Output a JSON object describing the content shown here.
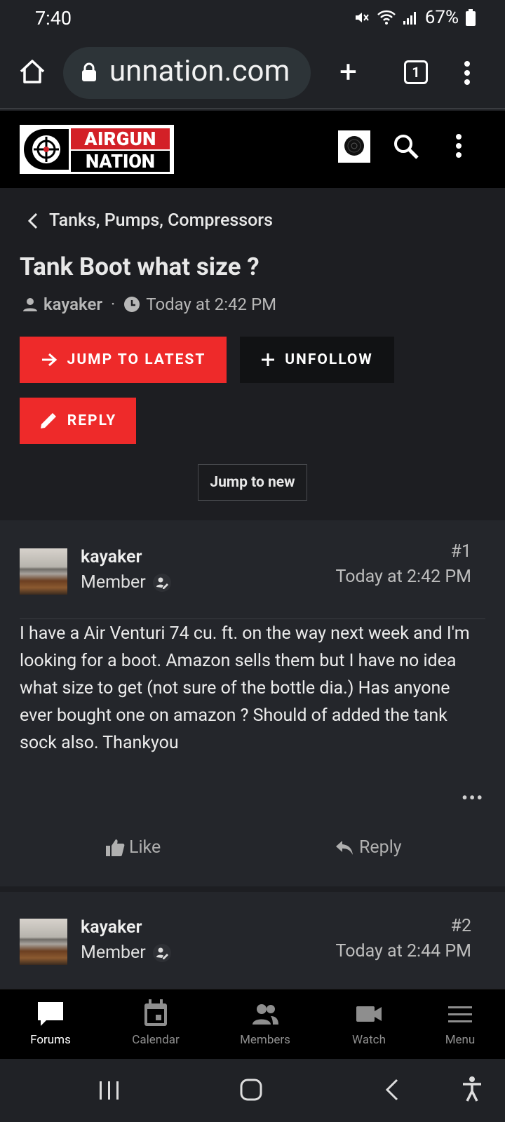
{
  "status_bar": {
    "time": "7:40",
    "battery": "67%"
  },
  "browser": {
    "url": "unnation.com",
    "tab_count": "1"
  },
  "site": {
    "logo_top": "AIRGUN",
    "logo_bottom": "NATION"
  },
  "thread": {
    "breadcrumb": "Tanks, Pumps, Compressors",
    "title": "Tank Boot what size ?",
    "author": "kayaker",
    "separator": "·",
    "time": "Today at 2:42 PM",
    "buttons": {
      "jump_latest": "JUMP TO LATEST",
      "unfollow": "UNFOLLOW",
      "reply": "REPLY",
      "jump_new": "Jump to new"
    }
  },
  "posts": [
    {
      "username": "kayaker",
      "role": "Member",
      "number": "#1",
      "time": "Today at 2:42 PM",
      "body": "I have a Air Venturi 74 cu. ft. on the way next week and I'm looking for a boot. Amazon sells them but I have no idea what size to get (not sure of the bottle dia.) Has anyone ever bought one on amazon ? Should of added the tank sock also. Thankyou",
      "more": "•••",
      "like_label": "Like",
      "reply_label": "Reply"
    },
    {
      "username": "kayaker",
      "role": "Member",
      "number": "#2",
      "time": "Today at 2:44 PM"
    }
  ],
  "bottom_nav": {
    "forums": "Forums",
    "calendar": "Calendar",
    "members": "Members",
    "watch": "Watch",
    "menu": "Menu"
  },
  "colors": {
    "accent_red": "#ee2a2a",
    "background": "#1d1e22",
    "post_bg": "#24262b"
  }
}
